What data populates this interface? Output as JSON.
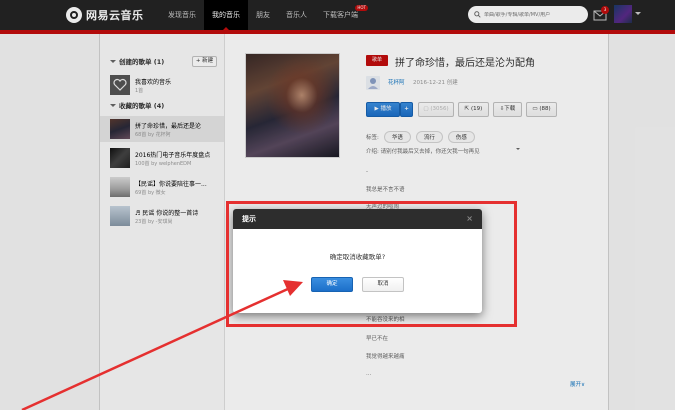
{
  "header": {
    "logo_text": "网易云音乐",
    "nav": [
      {
        "label": "发现音乐",
        "active": false
      },
      {
        "label": "我的音乐",
        "active": true
      },
      {
        "label": "朋友",
        "active": false
      },
      {
        "label": "音乐人",
        "active": false
      },
      {
        "label": "下载客户端",
        "active": false,
        "badge": "HOT"
      }
    ],
    "search_placeholder": "单曲/歌手/专辑/歌单/MV/用户",
    "mail_count": "3"
  },
  "sidebar": {
    "created_title": "创建的歌单 (1)",
    "new_label": "+ 新建",
    "created": [
      {
        "name": "我喜欢的音乐",
        "meta": "1首"
      }
    ],
    "collected_title": "收藏的歌单 (4)",
    "collected": [
      {
        "name": "拼了命珍惜，最后还是沦",
        "meta": "68首 by 花杯阿",
        "active": true
      },
      {
        "name": "2016热门电子音乐年度盘点",
        "meta": "100首 by welphenEDM",
        "active": false
      },
      {
        "name": "【民谣】你说要陪往事一...",
        "meta": "69首 by 微女",
        "active": false
      },
      {
        "name": "♬ 民谣 你说的整一首诗",
        "meta": "23首 by -安琪尚",
        "active": false
      }
    ]
  },
  "playlist": {
    "tag": "歌单",
    "title": "拼了命珍惜，最后还是沦为配角",
    "creator": "花杯阿",
    "date": "2016-12-21 创建",
    "play": "播放",
    "add": "+",
    "fav": "(3056)",
    "share": "(19)",
    "download": "下载",
    "comment": "(88)",
    "tags_label": "标签:",
    "tags": [
      "华语",
      "流行",
      "伤感"
    ],
    "intro": "介绍: 请别付我最后又去掉，你还欠我一句再见",
    "lyrics": [
      "我总是不言不语",
      "无声过的喧闹",
      "不能吞没来的相",
      "早已不在",
      "我觉得越来越痛"
    ],
    "expand": "展开"
  },
  "dialog": {
    "title": "提示",
    "close": "×",
    "message": "确定取消收藏歌单?",
    "ok": "确定",
    "cancel": "取消"
  },
  "colors": {
    "brand_red": "#c20c0c",
    "nav_bg": "#242424",
    "annotation_red": "#e53030",
    "link_blue": "#0c73c2"
  }
}
